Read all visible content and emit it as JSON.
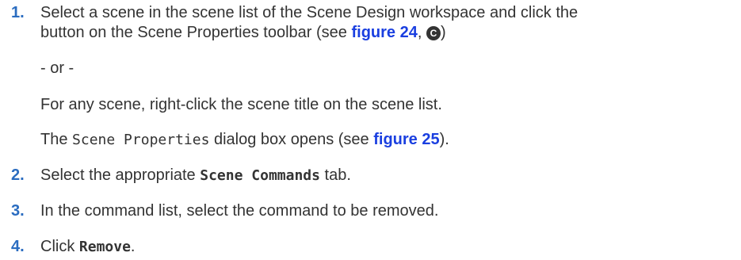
{
  "steps": [
    {
      "number": "1.",
      "line1": "Select a scene in the scene list of the Scene Design workspace and click the",
      "line2_prefix": "button on the Scene Properties toolbar (see ",
      "line2_link": "figure 24",
      "line2_sep": ", ",
      "line2_callout": "C",
      "line2_suffix": ")",
      "or_text": "- or -",
      "alt_text": "For any scene, right-click the scene title on the scene list.",
      "result_mono": "Scene Properties",
      "result_mid": " dialog box opens (see ",
      "result_prefix": "The ",
      "result_link": "figure 25",
      "result_suffix": ")."
    },
    {
      "number": "2.",
      "prefix": "Select the appropriate ",
      "bold_mono": "Scene Commands",
      "suffix": " tab."
    },
    {
      "number": "3.",
      "text": "In the command list, select the command to be removed."
    },
    {
      "number": "4.",
      "prefix": "Click ",
      "bold_mono": "Remove",
      "suffix": "."
    }
  ],
  "colors": {
    "number": "#2a6cc0",
    "link": "#1a3fe0",
    "text": "#333333"
  }
}
